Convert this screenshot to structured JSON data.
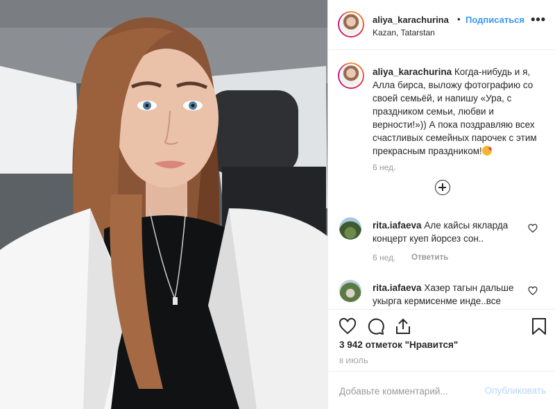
{
  "post": {
    "username": "aliya_karachurina",
    "separator": "•",
    "follow_label": "Подписаться",
    "location": "Kazan, Tatarstan",
    "more_label": "•••",
    "caption_line1": "Когда-нибудь и я,",
    "caption_line2": "Алла бирса, выложу фотографию со",
    "caption_line3": "своей семьёй, и напишу «Ура, с",
    "caption_line4": "праздником семьи, любви и",
    "caption_line5": "верности!»)) А пока поздравляю всех",
    "caption_line6": "счастливых семейных парочек с этим",
    "caption_line7": "прекрасным праздником!",
    "caption_time": "6 нед."
  },
  "comments": [
    {
      "username": "rita.iafaeva",
      "text_line1": "Але кайсы якларда",
      "text_line2": "концерт куеп йорсез сон..",
      "time": "6 нед.",
      "reply_label": "Ответить"
    },
    {
      "username": "rita.iafaeva",
      "text_line1": "Хазер тагын дальше",
      "text_line2": "укырга кермисенме инде..все"
    }
  ],
  "actions": {
    "likes_count": "3 942",
    "likes_suffix": "отметок \"Нравится\"",
    "date": "8 ИЮЛЬ"
  },
  "add_comment": {
    "placeholder": "Добавьте комментарий...",
    "publish_label": "Опубликовать"
  },
  "colors": {
    "accent": "#3897f0",
    "publish_disabled": "#b3d7f9",
    "muted": "#999999",
    "text": "#262626"
  },
  "icons": [
    "heart-icon",
    "comment-icon",
    "share-icon",
    "bookmark-icon",
    "plus-circle-icon",
    "more-icon"
  ]
}
